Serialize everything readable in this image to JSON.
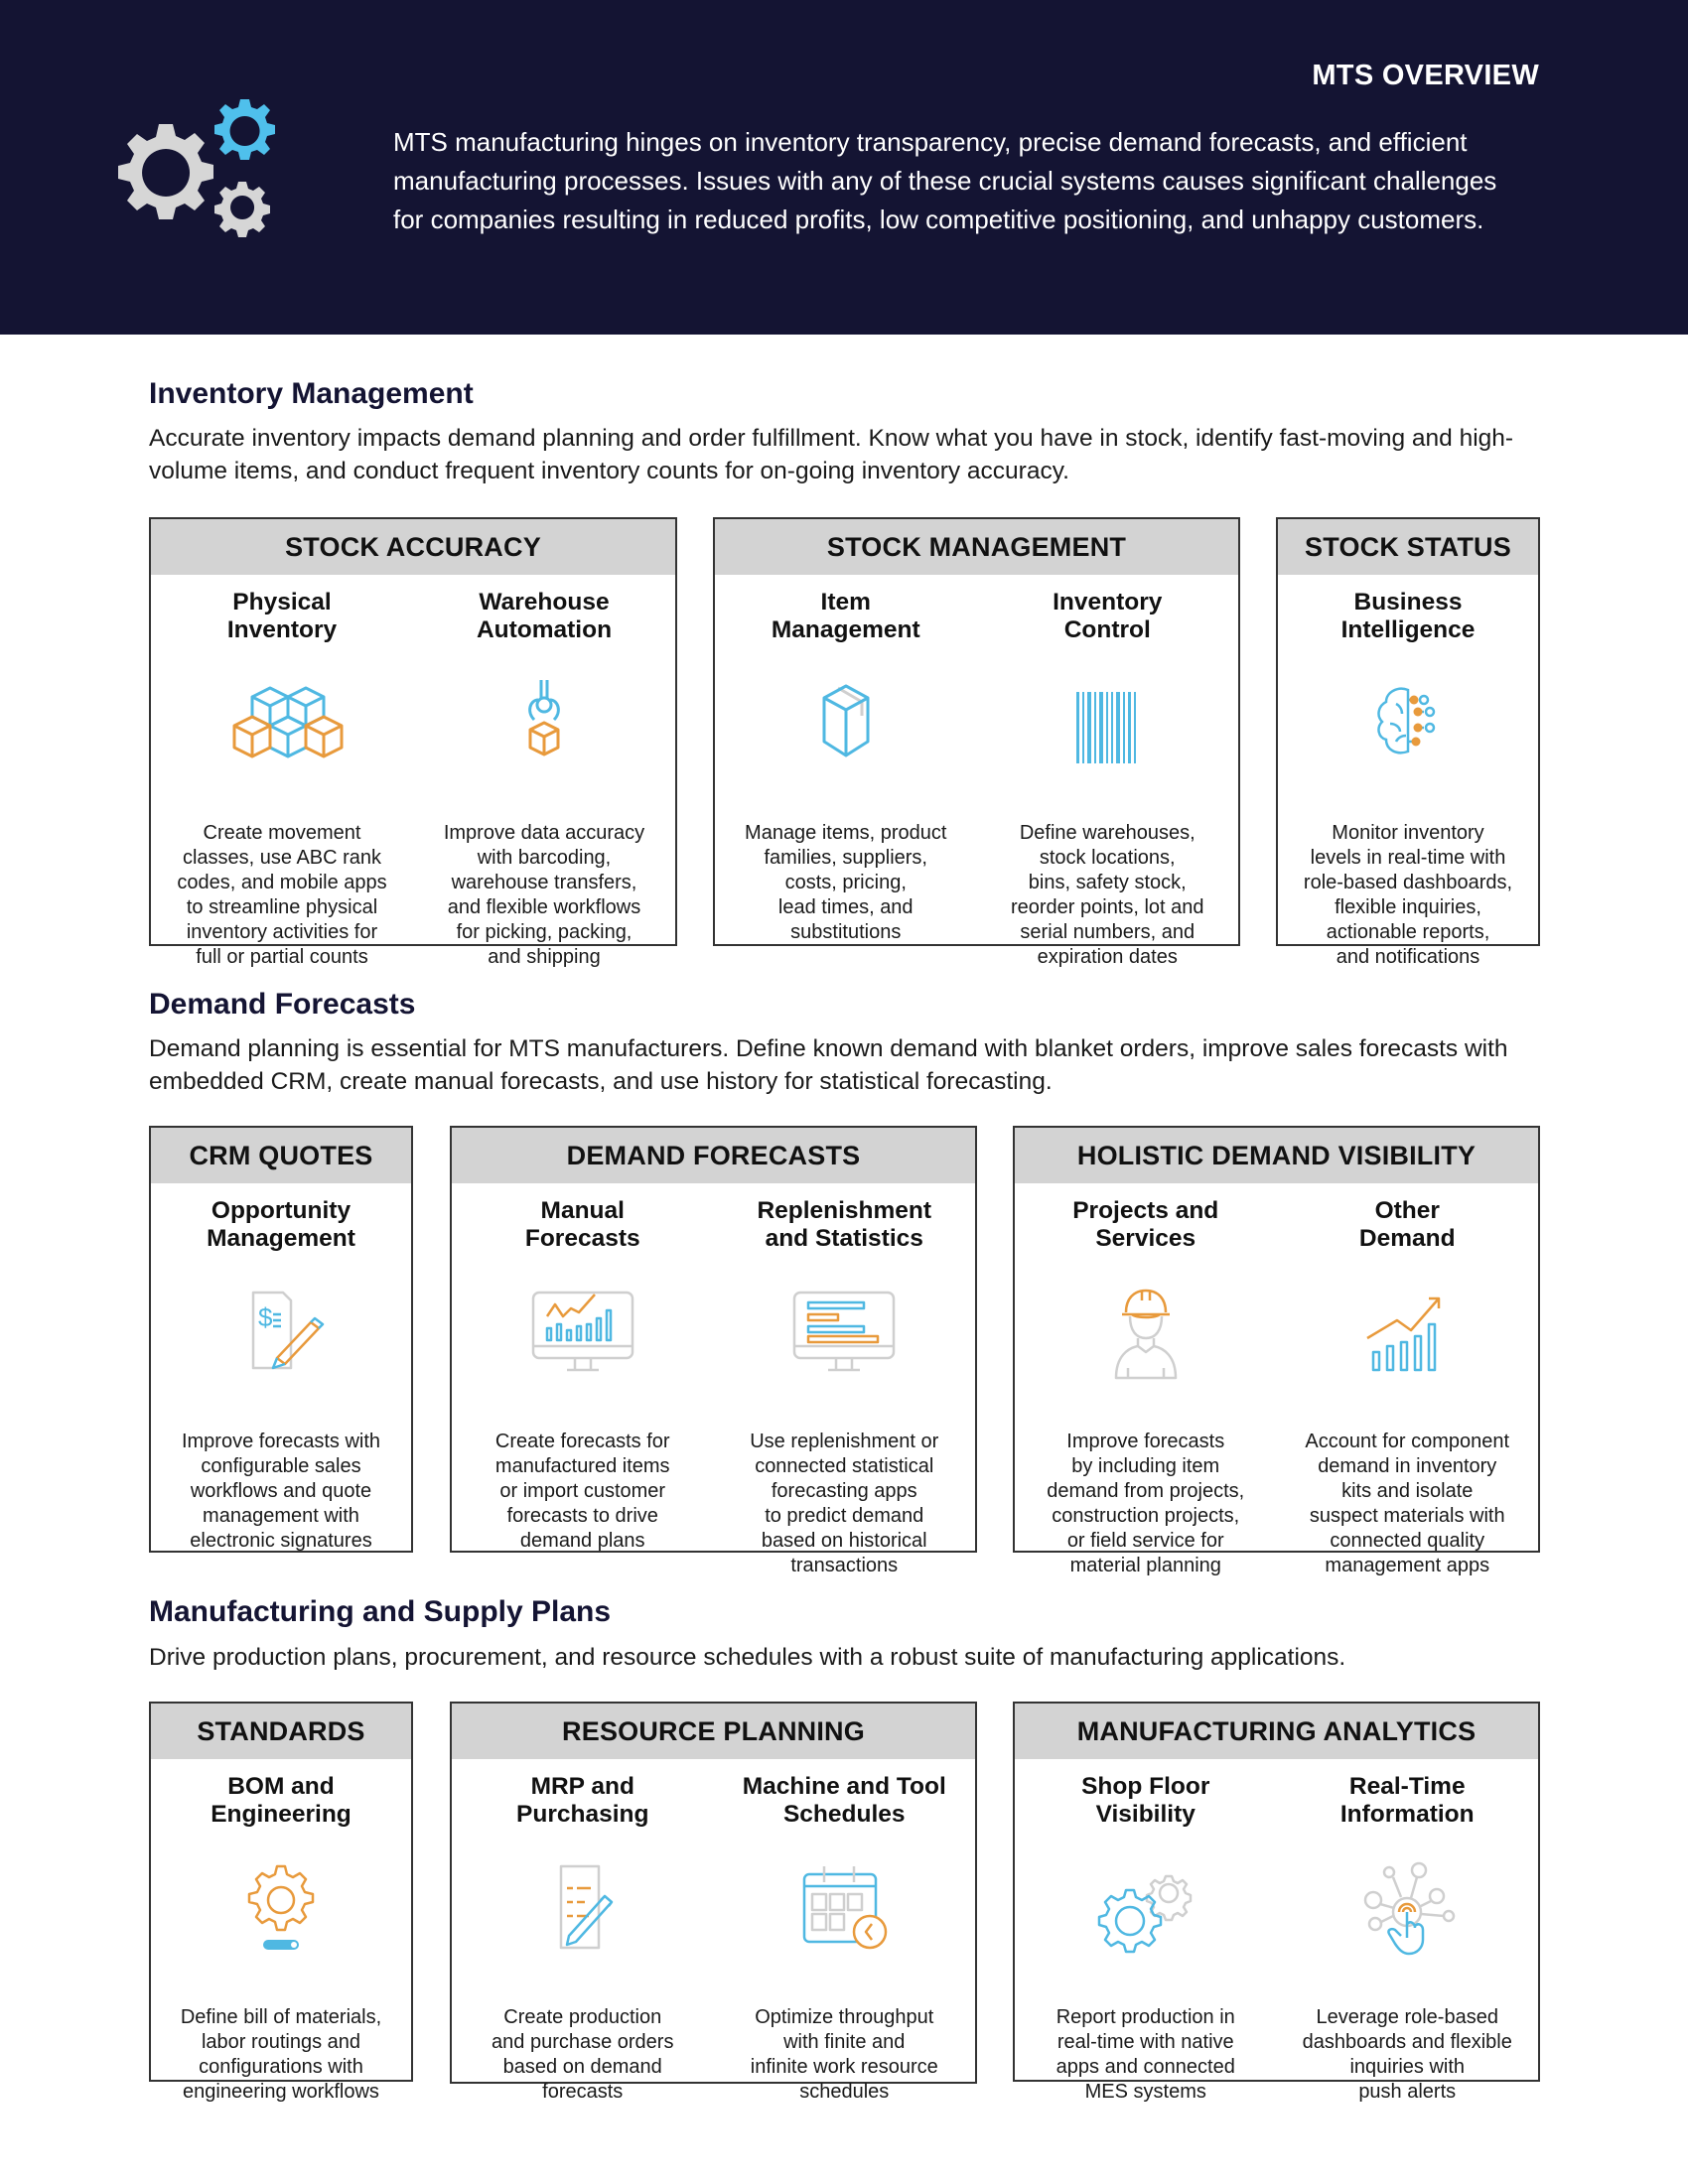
{
  "header": {
    "title": "MTS OVERVIEW",
    "icon": "gears-icon",
    "intro": "MTS manufacturing hinges on inventory transparency, precise demand forecasts, and efficient manufacturing processes. Issues with any of these crucial systems causes significant challenges for companies resulting in reduced profits, low competitive positioning, and unhappy customers."
  },
  "colors": {
    "header_bg": "#141433",
    "heading": "#141433",
    "card_header_bg": "#d3d3d3",
    "icon_blue": "#4fb8e2",
    "icon_orange": "#e89a3c",
    "icon_gray": "#cfcfcf"
  },
  "sections": [
    {
      "title": "Inventory Management",
      "description": "Accurate inventory impacts demand planning and order fulfillment. Know what you have in stock, identify fast-moving and high-volume items, and conduct frequent inventory counts for on-going inventory accuracy.",
      "cards": [
        {
          "heading": "STOCK ACCURACY",
          "columns": [
            {
              "title": "Physical\nInventory",
              "icon": "stacked-boxes-icon",
              "description": "Create movement\nclasses, use ABC rank\ncodes, and mobile apps\nto streamline physical\ninventory activities for\nfull or partial counts"
            },
            {
              "title": "Warehouse\nAutomation",
              "icon": "robotic-claw-icon",
              "description": "Improve data accuracy\nwith barcoding,\nwarehouse transfers,\nand flexible workflows\nfor picking, packing,\nand shipping"
            }
          ]
        },
        {
          "heading": "STOCK MANAGEMENT",
          "columns": [
            {
              "title": "Item\nManagement",
              "icon": "package-box-icon",
              "description": "Manage items, product\nfamilies, suppliers,\ncosts, pricing,\nlead times, and\nsubstitutions"
            },
            {
              "title": "Inventory\nControl",
              "icon": "barcode-icon",
              "description": "Define warehouses,\nstock locations,\nbins, safety stock,\nreorder points, lot and\nserial numbers, and\nexpiration dates"
            }
          ]
        },
        {
          "heading": "STOCK STATUS",
          "columns": [
            {
              "title": "Business\nIntelligence",
              "icon": "brain-circuit-icon",
              "description": "Monitor inventory\nlevels in real-time with\nrole-based dashboards,\nflexible inquiries,\nactionable reports,\nand notifications"
            }
          ]
        }
      ]
    },
    {
      "title": "Demand Forecasts",
      "description": "Demand planning is essential for MTS manufacturers. Define known demand with blanket orders, improve sales forecasts with embedded CRM, create manual forecasts, and use history for statistical forecasting.",
      "cards": [
        {
          "heading": "CRM QUOTES",
          "columns": [
            {
              "title": "Opportunity\nManagement",
              "icon": "quote-document-pencil-icon",
              "description": "Improve forecasts with\nconfigurable sales\nworkflows and quote\nmanagement with\nelectronic signatures"
            }
          ]
        },
        {
          "heading": "DEMAND FORECASTS",
          "columns": [
            {
              "title": "Manual\nForecasts",
              "icon": "monitor-chart-icon",
              "description": "Create forecasts for\nmanufactured items\nor import customer\nforecasts to drive\ndemand plans"
            },
            {
              "title": "Replenishment\nand Statistics",
              "icon": "monitor-bars-icon",
              "description": "Use replenishment or\nconnected statistical\nforecasting apps\nto predict demand\nbased on historical\ntransactions"
            }
          ]
        },
        {
          "heading": "HOLISTIC DEMAND VISIBILITY",
          "columns": [
            {
              "title": "Projects and\nServices",
              "icon": "worker-hardhat-icon",
              "description": "Improve forecasts\nby including item\ndemand from projects,\nconstruction projects,\nor field service for\nmaterial planning"
            },
            {
              "title": "Other\nDemand",
              "icon": "growth-chart-icon",
              "description": "Account for component\ndemand in inventory\nkits and isolate\nsuspect materials with\nconnected quality\nmanagement apps"
            }
          ]
        }
      ]
    },
    {
      "title": "Manufacturing and Supply Plans",
      "description": "Drive production plans, procurement, and resource schedules with a robust suite of manufacturing applications.",
      "cards": [
        {
          "heading": "STANDARDS",
          "columns": [
            {
              "title": "BOM and\nEngineering",
              "icon": "gear-progress-icon",
              "description": "Define bill of materials,\nlabor routings and\nconfigurations with\nengineering workflows"
            }
          ]
        },
        {
          "heading": "RESOURCE PLANNING",
          "columns": [
            {
              "title": "MRP and\nPurchasing",
              "icon": "document-pencil-icon",
              "description": "Create production\nand purchase orders\nbased on demand\nforecasts"
            },
            {
              "title": "Machine and Tool\nSchedules",
              "icon": "calendar-clock-icon",
              "description": "Optimize throughput\nwith finite and\ninfinite work resource\nschedules"
            }
          ]
        },
        {
          "heading": "MANUFACTURING ANALYTICS",
          "columns": [
            {
              "title": "Shop Floor\nVisibility",
              "icon": "gears-outline-icon",
              "description": "Report production in\nreal-time with native\napps and connected\nMES systems"
            },
            {
              "title": "Real-Time\nInformation",
              "icon": "touch-network-icon",
              "description": "Leverage role-based\ndashboards and flexible\ninquiries with\npush alerts"
            }
          ]
        }
      ]
    }
  ]
}
